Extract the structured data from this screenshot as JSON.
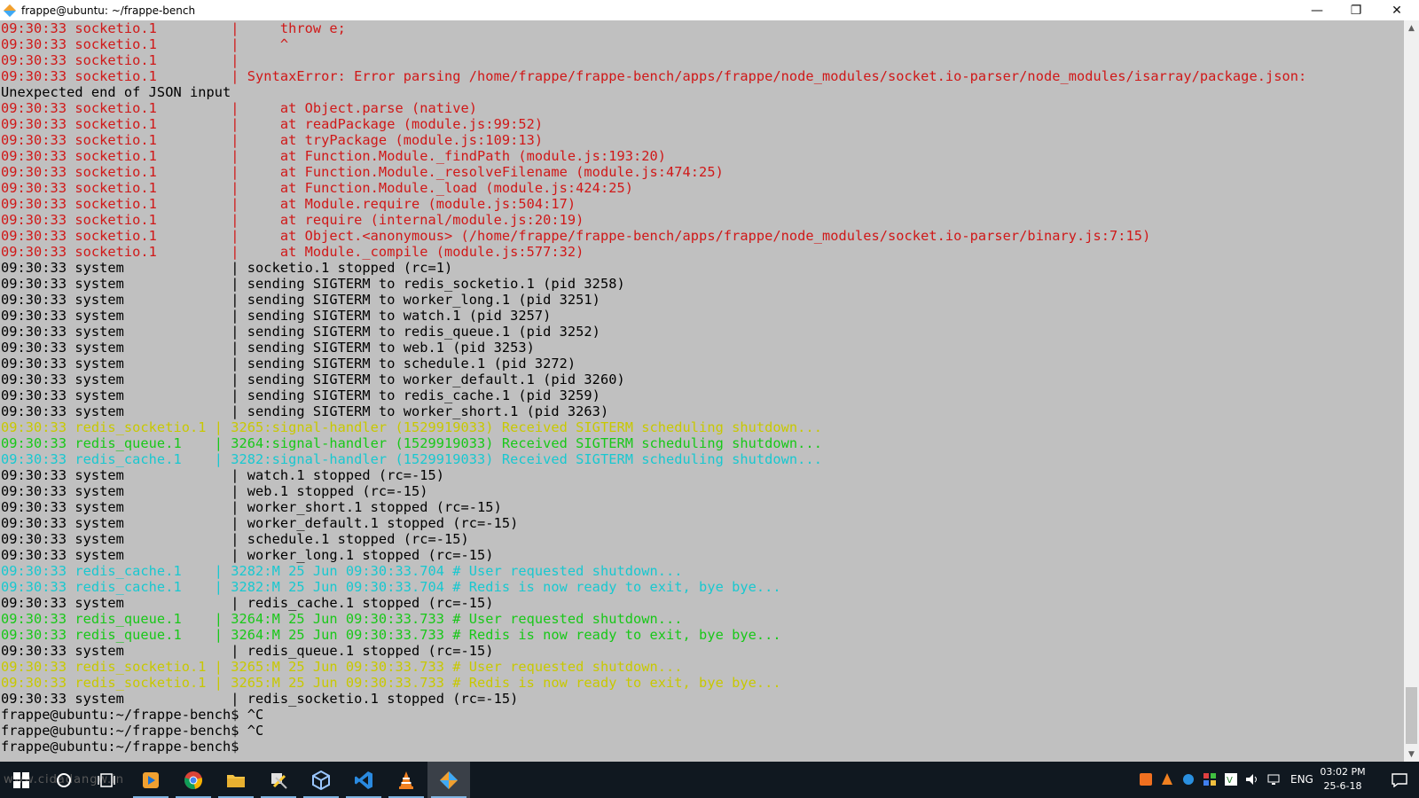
{
  "window": {
    "title": "frappe@ubuntu: ~/frappe-bench",
    "min_glyph": "—",
    "max_glyph": "❐",
    "close_glyph": "✕"
  },
  "terminal": {
    "background": "#c0c0c0",
    "lines": [
      {
        "color": "red",
        "text": "09:30:33 socketio.1         |     throw e;"
      },
      {
        "color": "red",
        "text": "09:30:33 socketio.1         |     ^"
      },
      {
        "color": "red",
        "text": "09:30:33 socketio.1         |"
      },
      {
        "color": "red",
        "text": "09:30:33 socketio.1         | SyntaxError: Error parsing /home/frappe/frappe-bench/apps/frappe/node_modules/socket.io-parser/node_modules/isarray/package.json:"
      },
      {
        "color": "def",
        "text": "Unexpected end of JSON input"
      },
      {
        "color": "red",
        "text": "09:30:33 socketio.1         |     at Object.parse (native)"
      },
      {
        "color": "red",
        "text": "09:30:33 socketio.1         |     at readPackage (module.js:99:52)"
      },
      {
        "color": "red",
        "text": "09:30:33 socketio.1         |     at tryPackage (module.js:109:13)"
      },
      {
        "color": "red",
        "text": "09:30:33 socketio.1         |     at Function.Module._findPath (module.js:193:20)"
      },
      {
        "color": "red",
        "text": "09:30:33 socketio.1         |     at Function.Module._resolveFilename (module.js:474:25)"
      },
      {
        "color": "red",
        "text": "09:30:33 socketio.1         |     at Function.Module._load (module.js:424:25)"
      },
      {
        "color": "red",
        "text": "09:30:33 socketio.1         |     at Module.require (module.js:504:17)"
      },
      {
        "color": "red",
        "text": "09:30:33 socketio.1         |     at require (internal/module.js:20:19)"
      },
      {
        "color": "red",
        "text": "09:30:33 socketio.1         |     at Object.<anonymous> (/home/frappe/frappe-bench/apps/frappe/node_modules/socket.io-parser/binary.js:7:15)"
      },
      {
        "color": "red",
        "text": "09:30:33 socketio.1         |     at Module._compile (module.js:577:32)"
      },
      {
        "color": "def",
        "text": "09:30:33 system             | socketio.1 stopped (rc=1)"
      },
      {
        "color": "def",
        "text": "09:30:33 system             | sending SIGTERM to redis_socketio.1 (pid 3258)"
      },
      {
        "color": "def",
        "text": "09:30:33 system             | sending SIGTERM to worker_long.1 (pid 3251)"
      },
      {
        "color": "def",
        "text": "09:30:33 system             | sending SIGTERM to watch.1 (pid 3257)"
      },
      {
        "color": "def",
        "text": "09:30:33 system             | sending SIGTERM to redis_queue.1 (pid 3252)"
      },
      {
        "color": "def",
        "text": "09:30:33 system             | sending SIGTERM to web.1 (pid 3253)"
      },
      {
        "color": "def",
        "text": "09:30:33 system             | sending SIGTERM to schedule.1 (pid 3272)"
      },
      {
        "color": "def",
        "text": "09:30:33 system             | sending SIGTERM to worker_default.1 (pid 3260)"
      },
      {
        "color": "def",
        "text": "09:30:33 system             | sending SIGTERM to redis_cache.1 (pid 3259)"
      },
      {
        "color": "def",
        "text": "09:30:33 system             | sending SIGTERM to worker_short.1 (pid 3263)"
      },
      {
        "color": "yellow",
        "text": "09:30:33 redis_socketio.1 | 3265:signal-handler (1529919033) Received SIGTERM scheduling shutdown..."
      },
      {
        "color": "green",
        "text": "09:30:33 redis_queue.1    | 3264:signal-handler (1529919033) Received SIGTERM scheduling shutdown..."
      },
      {
        "color": "cyan",
        "text": "09:30:33 redis_cache.1    | 3282:signal-handler (1529919033) Received SIGTERM scheduling shutdown..."
      },
      {
        "color": "def",
        "text": "09:30:33 system             | watch.1 stopped (rc=-15)"
      },
      {
        "color": "def",
        "text": "09:30:33 system             | web.1 stopped (rc=-15)"
      },
      {
        "color": "def",
        "text": "09:30:33 system             | worker_short.1 stopped (rc=-15)"
      },
      {
        "color": "def",
        "text": "09:30:33 system             | worker_default.1 stopped (rc=-15)"
      },
      {
        "color": "def",
        "text": "09:30:33 system             | schedule.1 stopped (rc=-15)"
      },
      {
        "color": "def",
        "text": "09:30:33 system             | worker_long.1 stopped (rc=-15)"
      },
      {
        "color": "cyan",
        "text": "09:30:33 redis_cache.1    | 3282:M 25 Jun 09:30:33.704 # User requested shutdown..."
      },
      {
        "color": "cyan",
        "text": "09:30:33 redis_cache.1    | 3282:M 25 Jun 09:30:33.704 # Redis is now ready to exit, bye bye..."
      },
      {
        "color": "def",
        "text": "09:30:33 system             | redis_cache.1 stopped (rc=-15)"
      },
      {
        "color": "green",
        "text": "09:30:33 redis_queue.1    | 3264:M 25 Jun 09:30:33.733 # User requested shutdown..."
      },
      {
        "color": "green",
        "text": "09:30:33 redis_queue.1    | 3264:M 25 Jun 09:30:33.733 # Redis is now ready to exit, bye bye..."
      },
      {
        "color": "def",
        "text": "09:30:33 system             | redis_queue.1 stopped (rc=-15)"
      },
      {
        "color": "yellow",
        "text": "09:30:33 redis_socketio.1 | 3265:M 25 Jun 09:30:33.733 # User requested shutdown..."
      },
      {
        "color": "yellow",
        "text": "09:30:33 redis_socketio.1 | 3265:M 25 Jun 09:30:33.733 # Redis is now ready to exit, bye bye..."
      },
      {
        "color": "def",
        "text": "09:30:33 system             | redis_socketio.1 stopped (rc=-15)"
      },
      {
        "color": "def",
        "text": "frappe@ubuntu:~/frappe-bench$ ^C"
      },
      {
        "color": "def",
        "text": "frappe@ubuntu:~/frappe-bench$ ^C"
      },
      {
        "color": "def",
        "text": "frappe@ubuntu:~/frappe-bench$ "
      }
    ]
  },
  "taskbar": {
    "watermark": "www.cidadangw.in",
    "lang": "ENG",
    "time": "03:02 PM",
    "date": "25-6-18",
    "apps": [
      "start-icon",
      "search-icon",
      "task-view-icon",
      "media-player-icon",
      "chrome-icon",
      "file-explorer-icon",
      "tools-icon",
      "virtualbox-icon",
      "vscode-icon",
      "vlc-icon",
      "git-icon"
    ]
  },
  "colors": {
    "red": "#d01818",
    "yellow": "#c8c800",
    "green": "#18c818",
    "cyan": "#18c8d0",
    "default": "#000000",
    "taskbar": "#101820"
  }
}
